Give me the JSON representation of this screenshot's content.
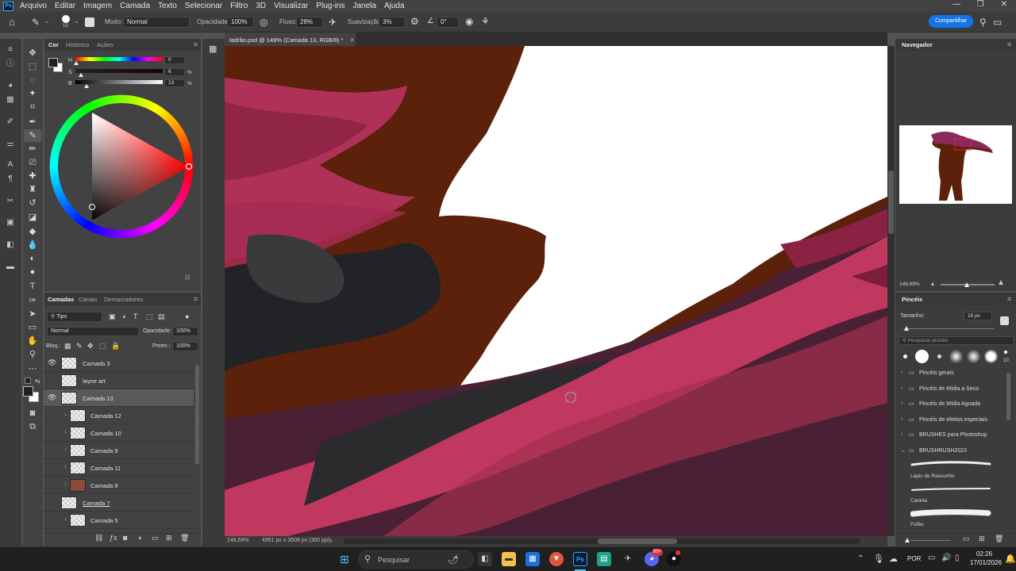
{
  "menubar": {
    "items": [
      "Arquivo",
      "Editar",
      "Imagem",
      "Camada",
      "Texto",
      "Selecionar",
      "Filtro",
      "3D",
      "Visualizar",
      "Plug-ins",
      "Janela",
      "Ajuda"
    ],
    "window_controls": [
      "—",
      "❐",
      "✕"
    ]
  },
  "options": {
    "brush_size": "15",
    "mode_label": "Modo:",
    "mode_value": "Normal",
    "opacity_label": "Opacidade:",
    "opacity_value": "100%",
    "flow_label": "Fluxo:",
    "flow_value": "28%",
    "smoothing_label": "Suavização:",
    "smoothing_value": "3%",
    "angle_value": "0°",
    "share_label": "Compartilhar"
  },
  "color_panel": {
    "tabs": [
      "Cor",
      "Histórico",
      "Ações"
    ],
    "h_label": "H",
    "h_value": "0",
    "s_label": "S",
    "s_value": "6",
    "s_unit": "%",
    "b_label": "B",
    "b_value": "13",
    "b_unit": "%",
    "hue": 0,
    "saturation": 0.06,
    "brightness": 0.13,
    "accent": "#ff0000"
  },
  "document": {
    "tab_title": "ladrão.psd @ 149% (Camada 13, RGB/8) *",
    "zoom_status": "148,69%",
    "size_status": "4961 px x 3508 px (300 ppi)"
  },
  "layers_panel": {
    "tabs": [
      "Camadas",
      "Canais",
      "Demarcadores"
    ],
    "filter_label": "Tipo",
    "blend_mode": "Normal",
    "opacity_label": "Opacidade:",
    "opacity_value": "100%",
    "lock_label": "Bloq.:",
    "fill_label": "Preen.:",
    "fill_value": "100%",
    "layers": [
      {
        "name": "Camada 3",
        "visible": true,
        "clipped": false,
        "selected": false
      },
      {
        "name": "layne art",
        "visible": false,
        "clipped": false,
        "selected": false
      },
      {
        "name": "Camada 13",
        "visible": true,
        "clipped": false,
        "selected": true
      },
      {
        "name": "Camada 12",
        "visible": false,
        "clipped": true,
        "selected": false
      },
      {
        "name": "Camada 10",
        "visible": false,
        "clipped": true,
        "selected": false
      },
      {
        "name": "Camada 9",
        "visible": false,
        "clipped": true,
        "selected": false
      },
      {
        "name": "Camada 11",
        "visible": false,
        "clipped": true,
        "selected": false
      },
      {
        "name": "Camada 8",
        "visible": false,
        "clipped": true,
        "selected": false
      },
      {
        "name": "Camada 7",
        "visible": false,
        "clipped": false,
        "selected": false
      },
      {
        "name": "Camada 5",
        "visible": false,
        "clipped": true,
        "selected": false
      }
    ]
  },
  "navigator": {
    "title": "Navegador",
    "zoom": "148,69%"
  },
  "brushes_panel": {
    "title": "Pincéis",
    "size_label": "Tamanho:",
    "size_value": "15 px",
    "search_placeholder": "Pesquisar pincéis",
    "preset_size": "10",
    "folders": [
      "Pincéis gerais",
      "Pincéis de Mídia a Seco",
      "Pincéis de Mídia Aguada",
      "Pincéis de efeitos especiais",
      "BRUSHES para Photoshop",
      "BRUSHRUSH2023"
    ],
    "brushes": [
      "Lápis de Rascunho",
      "Caneta",
      "Fofão"
    ]
  },
  "taskbar": {
    "search_placeholder": "Pesquisar",
    "language": "POR",
    "time": "02:26",
    "date": "17/01/2026",
    "notification_count": "99+"
  }
}
